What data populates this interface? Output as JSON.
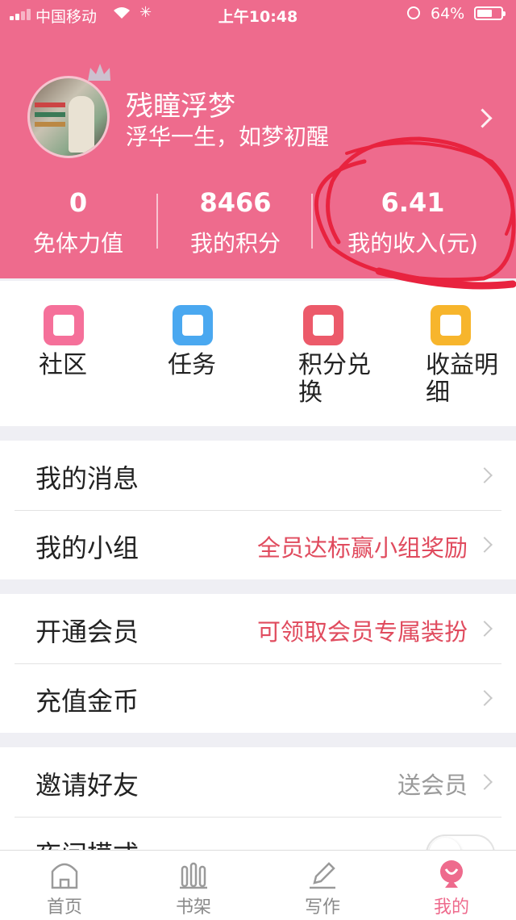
{
  "status_bar": {
    "carrier": "中国移动",
    "time": "上午10:48",
    "battery_percent": "64%",
    "battery_level": 0.64
  },
  "profile": {
    "name": "残瞳浮梦",
    "signature": "浮华一生，如梦初醒"
  },
  "stats": [
    {
      "value": "0",
      "label": "免体力值"
    },
    {
      "value": "8466",
      "label": "我的积分"
    },
    {
      "value": "6.41",
      "label": "我的收入(元)"
    }
  ],
  "quick_actions": [
    {
      "label": "社区",
      "icon": "heart-icon",
      "color": "#f5709a"
    },
    {
      "label": "任务",
      "icon": "list-icon",
      "color": "#4aa8f0"
    },
    {
      "label": "积分兑换",
      "icon": "gift-icon",
      "color": "#ec5a6a"
    },
    {
      "label": "收益明细",
      "icon": "piggy-bank-icon",
      "color": "#f7b52c"
    }
  ],
  "menu": {
    "messages": {
      "label": "我的消息"
    },
    "group": {
      "label": "我的小组",
      "hint": "全员达标赢小组奖励"
    },
    "vip": {
      "label": "开通会员",
      "hint": "可领取会员专属装扮"
    },
    "coins": {
      "label": "充值金币"
    },
    "invite": {
      "label": "邀请好友",
      "hint": "送会员"
    },
    "night": {
      "label": "夜间模式",
      "enabled": false
    }
  },
  "tabs": [
    {
      "label": "首页",
      "icon": "home-icon"
    },
    {
      "label": "书架",
      "icon": "bookshelf-icon"
    },
    {
      "label": "写作",
      "icon": "pen-icon"
    },
    {
      "label": "我的",
      "icon": "profile-icon"
    }
  ],
  "colors": {
    "accent": "#ee6b8d",
    "hint": "#e04b5e",
    "annotation": "#e8233f"
  }
}
